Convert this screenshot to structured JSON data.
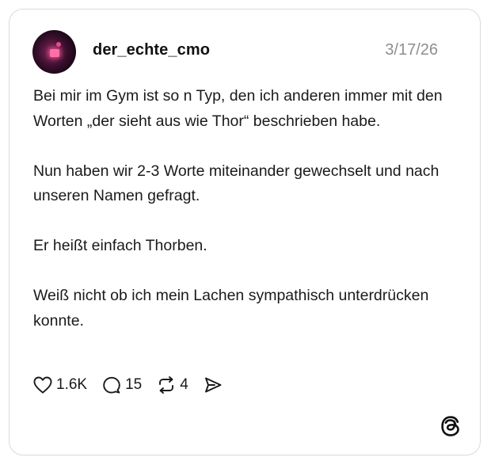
{
  "post": {
    "username": "der_echte_cmo",
    "date": "3/17/26",
    "paragraphs": [
      "Bei mir im Gym ist so n Typ, den ich anderen immer mit den Worten „der sieht aus wie Thor“ beschrieben habe.",
      "Nun haben wir 2-3 Worte miteinander gewechselt und nach unseren Namen gefragt.",
      "Er heißt einfach Thorben.",
      "Weiß nicht ob ich mein Lachen sympathisch unterdrücken konnte."
    ]
  },
  "actions": {
    "likes": "1.6K",
    "replies": "15",
    "reposts": "4"
  },
  "icons": {
    "like": "heart-icon",
    "reply": "comment-icon",
    "repost": "repost-icon",
    "share": "send-icon",
    "brand": "threads-logo-icon"
  },
  "colors": {
    "text": "#1a1a1a",
    "muted": "#8e8e8e",
    "border": "#dadada"
  }
}
